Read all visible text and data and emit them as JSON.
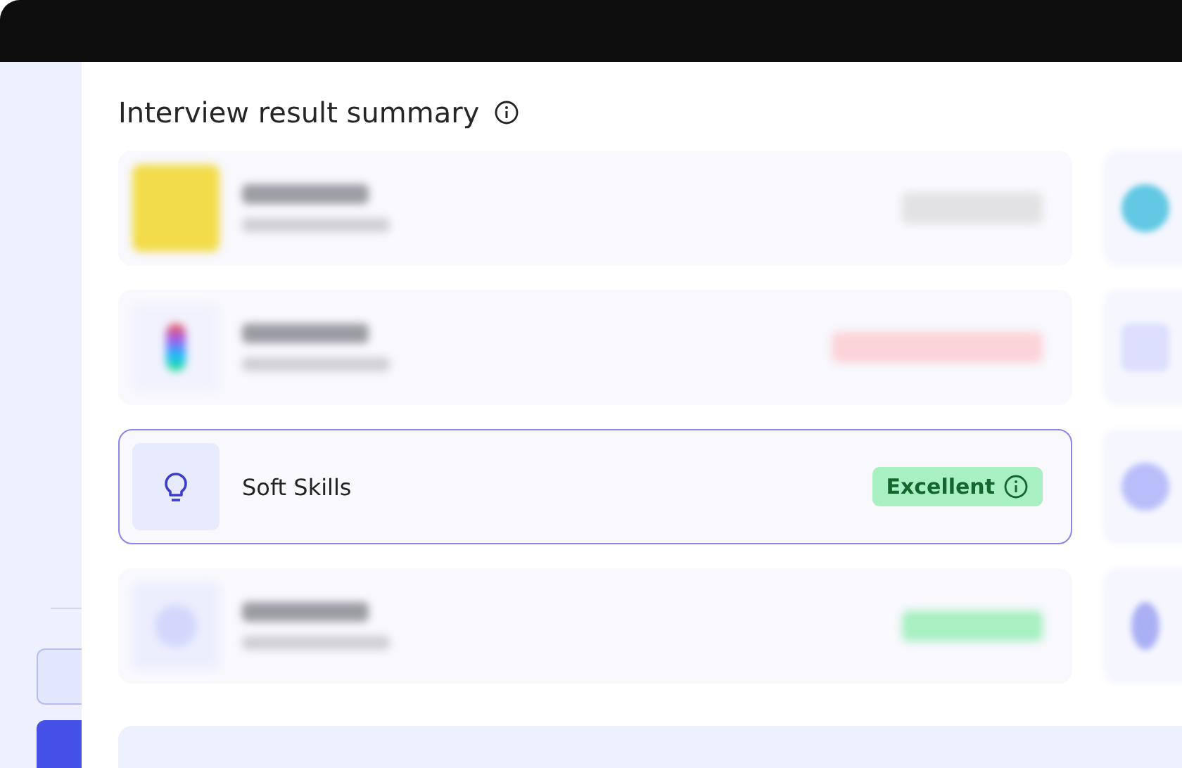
{
  "title": "Interview result summary",
  "results": [
    {
      "kind": "blurred",
      "thumb": {
        "kind": "photo"
      },
      "badge": {
        "color": "#e2e2e4"
      }
    },
    {
      "kind": "blurred",
      "thumb": {
        "kind": "logo"
      },
      "badge": {
        "color": "#fbd3d8"
      }
    },
    {
      "kind": "focused",
      "thumb": {
        "kind": "lightbulb"
      },
      "name": "Soft Skills",
      "badge": {
        "label": "Excellent",
        "color": "#a8efc2"
      }
    },
    {
      "kind": "blurred",
      "thumb": {
        "kind": "plain"
      },
      "badge": {
        "color": "#a8efc2"
      }
    }
  ]
}
